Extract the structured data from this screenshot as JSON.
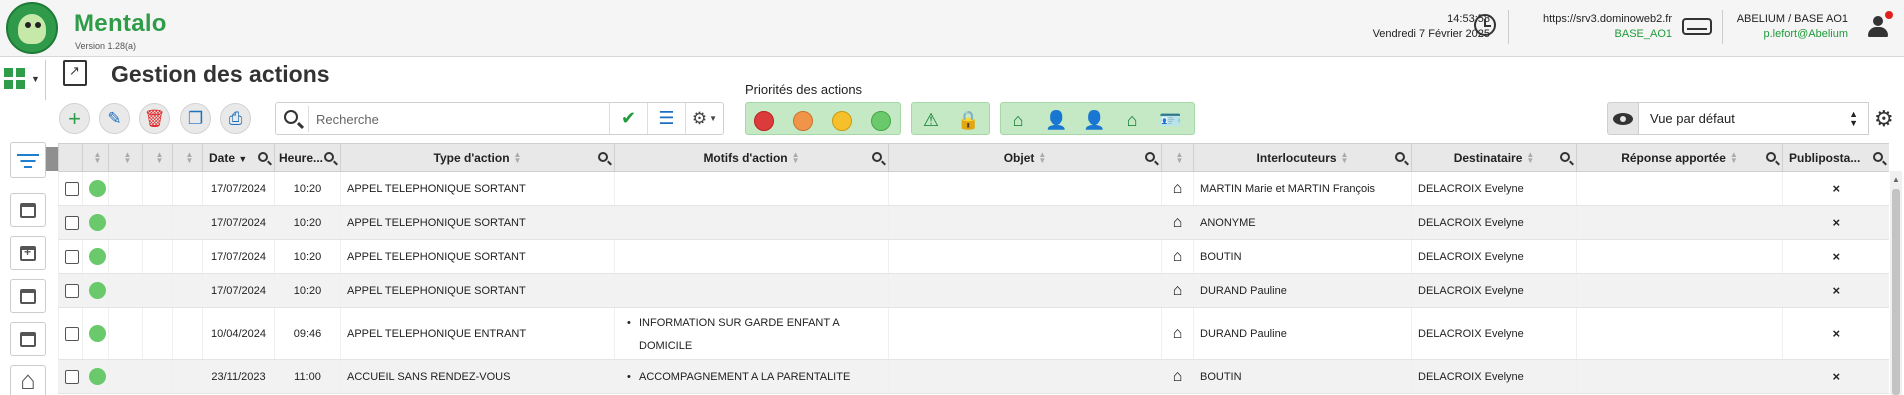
{
  "app": {
    "name": "Mentalo",
    "version": "Version 1.28(a)"
  },
  "header": {
    "time": "14:53:58",
    "date": "Vendredi 7 Février 2025",
    "server_url": "https://srv3.dominoweb2.fr",
    "server_base": "BASE_AO1",
    "org": "ABELIUM / BASE AO1",
    "user_email": "p.lefort@Abelium"
  },
  "page": {
    "title": "Gestion des actions",
    "priorities_label": "Priorités des actions"
  },
  "toolbar": {
    "tooltip": "Ajouter",
    "search_placeholder": "Recherche",
    "view_selected": "Vue par défaut"
  },
  "colors": {
    "brand_green": "#2e9c48",
    "priority_red": "#dc3b3b",
    "priority_orange": "#f0944a",
    "priority_yellow": "#f6c02b",
    "priority_green": "#69c96b",
    "group_bg": "#c4e9c4"
  },
  "table": {
    "headers": {
      "date": "Date",
      "heure": "Heure...",
      "type": "Type d'action",
      "motifs": "Motifs d'action",
      "objet": "Objet",
      "interlocuteurs": "Interlocuteurs",
      "destinataire": "Destinataire",
      "reponse": "Réponse apportée",
      "publipostage": "Publiposta..."
    },
    "rows": [
      {
        "date": "17/07/2024",
        "heure": "10:20",
        "type": "APPEL TELEPHONIQUE SORTANT",
        "motifs": [],
        "interlocuteur": "MARTIN Marie et MARTIN François",
        "destinataire": "DELACROIX Evelyne",
        "publi": "×"
      },
      {
        "date": "17/07/2024",
        "heure": "10:20",
        "type": "APPEL TELEPHONIQUE SORTANT",
        "motifs": [],
        "interlocuteur": "ANONYME",
        "destinataire": "DELACROIX Evelyne",
        "publi": "×"
      },
      {
        "date": "17/07/2024",
        "heure": "10:20",
        "type": "APPEL TELEPHONIQUE SORTANT",
        "motifs": [],
        "interlocuteur": "BOUTIN",
        "destinataire": "DELACROIX Evelyne",
        "publi": "×"
      },
      {
        "date": "17/07/2024",
        "heure": "10:20",
        "type": "APPEL TELEPHONIQUE SORTANT",
        "motifs": [],
        "interlocuteur": "DURAND Pauline",
        "destinataire": "DELACROIX Evelyne",
        "publi": "×"
      },
      {
        "date": "10/04/2024",
        "heure": "09:46",
        "type": "APPEL TELEPHONIQUE ENTRANT",
        "motifs": [
          "INFORMATION SUR GARDE ENFANT A",
          "DOMICILE"
        ],
        "interlocuteur": "DURAND Pauline",
        "destinataire": "DELACROIX Evelyne",
        "publi": "×"
      },
      {
        "date": "23/11/2023",
        "heure": "11:00",
        "type": "ACCUEIL SANS RENDEZ-VOUS",
        "motifs": [
          "ACCOMPAGNEMENT A LA PARENTALITE"
        ],
        "interlocuteur": "BOUTIN",
        "destinataire": "DELACROIX Evelyne",
        "publi": "×"
      }
    ]
  }
}
